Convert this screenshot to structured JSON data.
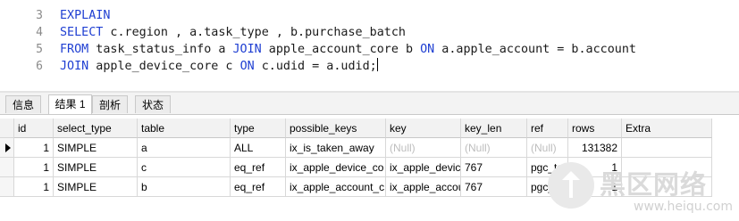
{
  "editor": {
    "line_numbers": [
      "3",
      "4",
      "5",
      "6"
    ],
    "lines": [
      [
        {
          "t": "EXPLAIN",
          "kw": true
        }
      ],
      [
        {
          "t": "SELECT",
          "kw": true
        },
        {
          "t": " c.region , a.task_type , b.purchase_batch",
          "kw": false
        }
      ],
      [
        {
          "t": "FROM",
          "kw": true
        },
        {
          "t": " task_status_info a ",
          "kw": false
        },
        {
          "t": "JOIN",
          "kw": true
        },
        {
          "t": " apple_account_core b ",
          "kw": false
        },
        {
          "t": "ON",
          "kw": true
        },
        {
          "t": " a.apple_account = b.account",
          "kw": false
        }
      ],
      [
        {
          "t": "JOIN",
          "kw": true
        },
        {
          "t": " apple_device_core c ",
          "kw": false
        },
        {
          "t": "ON",
          "kw": true
        },
        {
          "t": " c.udid = a.udid;",
          "kw": false
        }
      ]
    ],
    "keyword_color": "#1f3fd2"
  },
  "tabs": [
    {
      "label": "信息",
      "active": false
    },
    {
      "label": "结果 1",
      "active": true
    },
    {
      "label": "剖析",
      "active": false
    },
    {
      "label": "状态",
      "active": false
    }
  ],
  "result": {
    "columns": [
      "id",
      "select_type",
      "table",
      "type",
      "possible_keys",
      "key",
      "key_len",
      "ref",
      "rows",
      "Extra"
    ],
    "rows": [
      [
        "1",
        "SIMPLE",
        "a",
        "ALL",
        "ix_is_taken_away",
        "(Null)",
        "(Null)",
        "(Null)",
        "131382",
        ""
      ],
      [
        "1",
        "SIMPLE",
        "c",
        "eq_ref",
        "ix_apple_device_co",
        "ix_apple_devic",
        "767",
        "pgc_tes",
        "1",
        ""
      ],
      [
        "1",
        "SIMPLE",
        "b",
        "eq_ref",
        "ix_apple_account_c",
        "ix_apple_accou",
        "767",
        "pgc_tes",
        "1",
        ""
      ]
    ],
    "current_row": 0
  },
  "watermark": {
    "title": "黑区网络",
    "url": "www.heiqu.com"
  }
}
